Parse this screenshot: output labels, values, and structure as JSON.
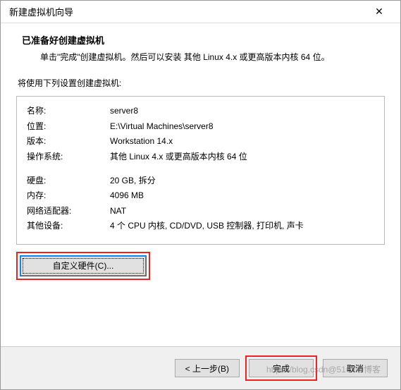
{
  "window": {
    "title": "新建虚拟机向导"
  },
  "header": {
    "heading": "已准备好创建虚拟机",
    "description": "单击\"完成\"创建虚拟机。然后可以安装 其他 Linux 4.x 或更高版本内核 64 位。"
  },
  "content": {
    "subheading": "将使用下列设置创建虚拟机:",
    "rows": {
      "name_label": "名称:",
      "name_value": "server8",
      "location_label": "位置:",
      "location_value": "E:\\Virtual Machines\\server8",
      "version_label": "版本:",
      "version_value": "Workstation 14.x",
      "os_label": "操作系统:",
      "os_value": "其他 Linux 4.x 或更高版本内核 64 位",
      "disk_label": "硬盘:",
      "disk_value": "20 GB, 拆分",
      "memory_label": "内存:",
      "memory_value": "4096 MB",
      "network_label": "网络适配器:",
      "network_value": "NAT",
      "other_label": "其他设备:",
      "other_value": "4 个 CPU 内核, CD/DVD, USB 控制器, 打印机, 声卡"
    },
    "customize_button": "自定义硬件(C)..."
  },
  "footer": {
    "back": "< 上一步(B)",
    "finish": "完成",
    "cancel": "取消"
  },
  "watermark": "https://blog.csdn@51CTO博客"
}
